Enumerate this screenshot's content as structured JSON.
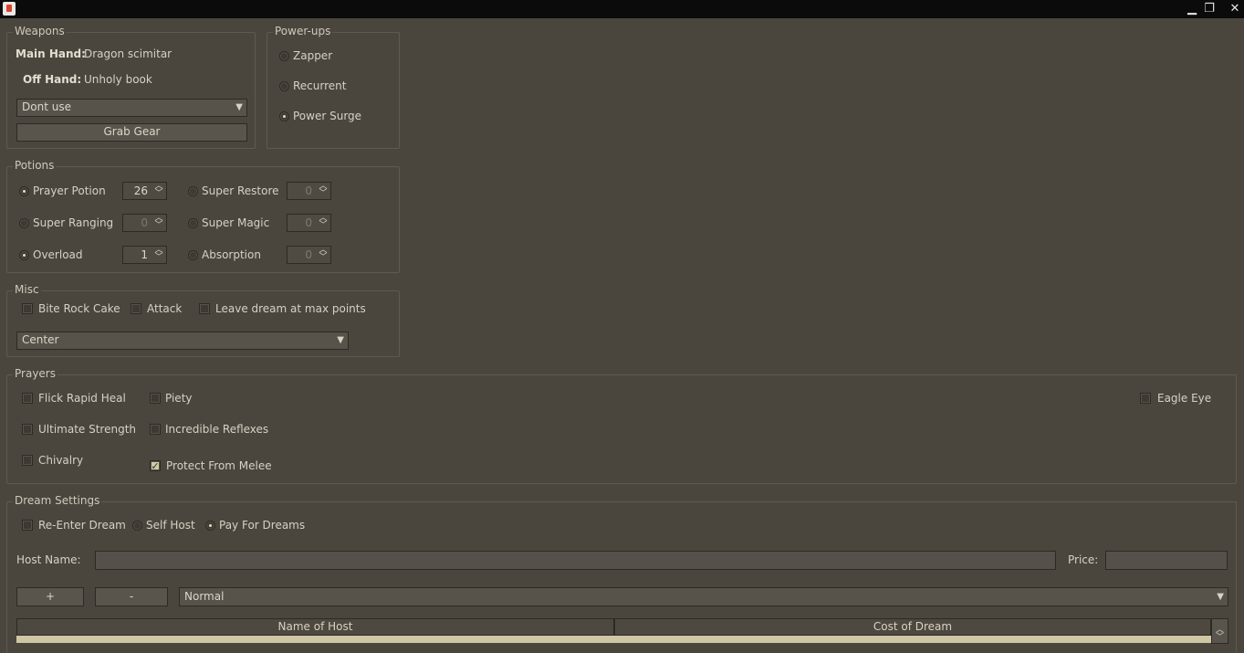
{
  "window": {
    "minimize_glyph": "▁",
    "restore_glyph": "❐",
    "close_glyph": "✕"
  },
  "weapons": {
    "title": "Weapons",
    "main_hand_label": "Main Hand:",
    "main_hand_value": "Dragon scimitar",
    "off_hand_label": "Off Hand:",
    "off_hand_value": "Unholy book",
    "special_select": "Dont use",
    "grab_gear": "Grab Gear"
  },
  "powerups": {
    "title": "Power-ups",
    "items": [
      {
        "label": "Zapper",
        "selected": false
      },
      {
        "label": "Recurrent",
        "selected": false
      },
      {
        "label": "Power Surge",
        "selected": true
      }
    ]
  },
  "potions": {
    "title": "Potions",
    "items": [
      {
        "label": "Prayer Potion",
        "value": "26",
        "selected": true
      },
      {
        "label": "Super Ranging",
        "value": "0",
        "selected": false
      },
      {
        "label": "Overload",
        "value": "1",
        "selected": true
      },
      {
        "label": "Super Restore",
        "value": "0",
        "selected": false
      },
      {
        "label": "Super Magic",
        "value": "0",
        "selected": false
      },
      {
        "label": "Absorption",
        "value": "0",
        "selected": false
      }
    ]
  },
  "misc": {
    "title": "Misc",
    "bite_rock_cake": "Bite Rock Cake",
    "attack": "Attack",
    "leave_dream": "Leave dream at max points",
    "position_select": "Center"
  },
  "prayers": {
    "title": "Prayers",
    "flick_rapid_heal": "Flick Rapid Heal",
    "ultimate_strength": "Ultimate Strength",
    "chivalry": "Chivalry",
    "piety": "Piety",
    "incredible_reflexes": "Incredible Reflexes",
    "protect_from_melee": "Protect From Melee",
    "eagle_eye": "Eagle Eye",
    "check_glyph": "✓"
  },
  "dream": {
    "title": "Dream Settings",
    "re_enter": "Re-Enter Dream",
    "self_host": "Self Host",
    "pay_for_dreams": "Pay For Dreams",
    "host_name_label": "Host Name:",
    "host_name_value": "",
    "price_label": "Price:",
    "price_value": "",
    "add_button": "+",
    "remove_button": "-",
    "mode_select": "Normal",
    "table": {
      "columns": [
        "Name of Host",
        "Cost of Dream"
      ]
    }
  }
}
